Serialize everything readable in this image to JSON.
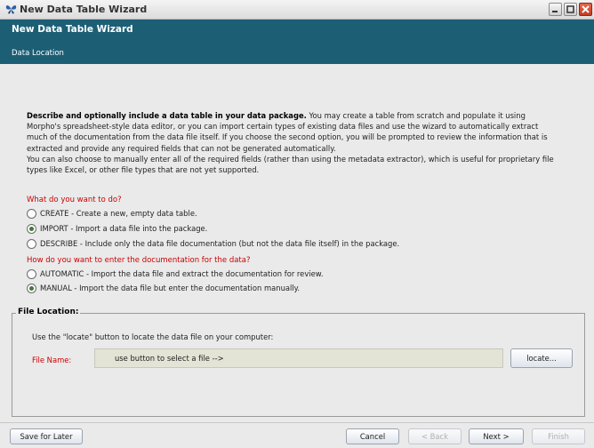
{
  "window": {
    "title": "New Data Table Wizard",
    "icon": "morpho-butterfly-icon"
  },
  "header": {
    "title": "New Data Table Wizard",
    "subtitle": "Data Location"
  },
  "intro": {
    "bold": "Describe and optionally include a data table in your data package.",
    "text1": " You may create a table from scratch and populate it using Morpho's spreadsheet-style data editor, or you can import certain types of existing data files and use the wizard to automatically extract much of the documentation from the data file itself. If you choose the second option, you will be prompted to review the information that is extracted and provide any required fields that can not be generated automatically.",
    "text2": "You can also choose to manually enter all of the required fields (rather than using the metadata extractor), which is useful for proprietary file types like Excel, or other file types that are not yet supported."
  },
  "question1": {
    "label": "What do you want to do?",
    "options": [
      {
        "label": "CREATE - Create a new, empty data table.",
        "selected": false
      },
      {
        "label": "IMPORT - Import a data file into the package.",
        "selected": true
      },
      {
        "label": "DESCRIBE - Include only the data file documentation (but not the data file itself) in the package.",
        "selected": false
      }
    ]
  },
  "question2": {
    "label": "How do you want to enter the documentation for the data?",
    "options": [
      {
        "label": "AUTOMATIC - Import the data file and extract the documentation for review.",
        "selected": false
      },
      {
        "label": "MANUAL - Import the data file but enter the documentation manually.",
        "selected": true
      }
    ]
  },
  "file_location": {
    "legend": "File Location:",
    "hint": "Use the \"locate\" button to locate the data file on your computer:",
    "file_name_label": "File Name:",
    "file_name_value": "use button to select a file -->",
    "locate_button": "locate..."
  },
  "footer": {
    "save_later": "Save for Later",
    "cancel": "Cancel",
    "back": "< Back",
    "next": "Next >",
    "finish": "Finish"
  },
  "colors": {
    "header_bg": "#1c5f75",
    "question_red": "#cc0000",
    "radio_selected": "#3d7a33"
  }
}
